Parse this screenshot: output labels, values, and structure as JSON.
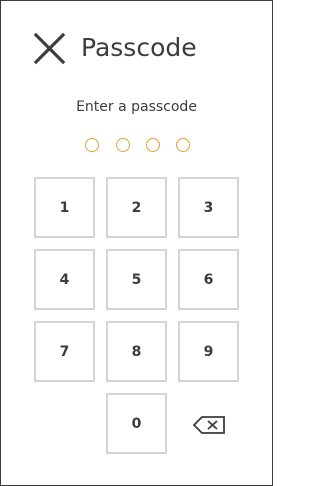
{
  "header": {
    "title": "Passcode",
    "close_icon": "close-x-icon"
  },
  "prompt": "Enter a passcode",
  "passcode": {
    "length": 4,
    "entered": 0,
    "dot_color": "#e8a33a"
  },
  "keypad": {
    "keys": [
      "1",
      "2",
      "3",
      "4",
      "5",
      "6",
      "7",
      "8",
      "9",
      "0"
    ],
    "backspace_icon": "backspace-icon"
  },
  "colors": {
    "text": "#3c3c3c",
    "key_border": "#d4d4d4",
    "accent": "#e8a33a"
  }
}
